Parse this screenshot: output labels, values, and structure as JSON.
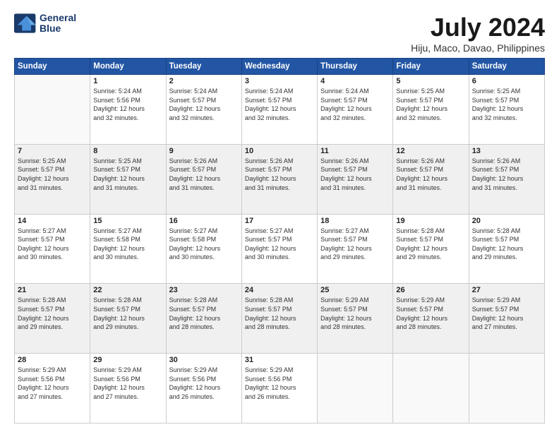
{
  "logo": {
    "line1": "General",
    "line2": "Blue"
  },
  "title": "July 2024",
  "location": "Hiju, Maco, Davao, Philippines",
  "days_of_week": [
    "Sunday",
    "Monday",
    "Tuesday",
    "Wednesday",
    "Thursday",
    "Friday",
    "Saturday"
  ],
  "weeks": [
    [
      {
        "day": "",
        "info": ""
      },
      {
        "day": "1",
        "info": "Sunrise: 5:24 AM\nSunset: 5:56 PM\nDaylight: 12 hours\nand 32 minutes."
      },
      {
        "day": "2",
        "info": "Sunrise: 5:24 AM\nSunset: 5:57 PM\nDaylight: 12 hours\nand 32 minutes."
      },
      {
        "day": "3",
        "info": "Sunrise: 5:24 AM\nSunset: 5:57 PM\nDaylight: 12 hours\nand 32 minutes."
      },
      {
        "day": "4",
        "info": "Sunrise: 5:24 AM\nSunset: 5:57 PM\nDaylight: 12 hours\nand 32 minutes."
      },
      {
        "day": "5",
        "info": "Sunrise: 5:25 AM\nSunset: 5:57 PM\nDaylight: 12 hours\nand 32 minutes."
      },
      {
        "day": "6",
        "info": "Sunrise: 5:25 AM\nSunset: 5:57 PM\nDaylight: 12 hours\nand 32 minutes."
      }
    ],
    [
      {
        "day": "7",
        "info": "Sunrise: 5:25 AM\nSunset: 5:57 PM\nDaylight: 12 hours\nand 31 minutes."
      },
      {
        "day": "8",
        "info": "Sunrise: 5:25 AM\nSunset: 5:57 PM\nDaylight: 12 hours\nand 31 minutes."
      },
      {
        "day": "9",
        "info": "Sunrise: 5:26 AM\nSunset: 5:57 PM\nDaylight: 12 hours\nand 31 minutes."
      },
      {
        "day": "10",
        "info": "Sunrise: 5:26 AM\nSunset: 5:57 PM\nDaylight: 12 hours\nand 31 minutes."
      },
      {
        "day": "11",
        "info": "Sunrise: 5:26 AM\nSunset: 5:57 PM\nDaylight: 12 hours\nand 31 minutes."
      },
      {
        "day": "12",
        "info": "Sunrise: 5:26 AM\nSunset: 5:57 PM\nDaylight: 12 hours\nand 31 minutes."
      },
      {
        "day": "13",
        "info": "Sunrise: 5:26 AM\nSunset: 5:57 PM\nDaylight: 12 hours\nand 31 minutes."
      }
    ],
    [
      {
        "day": "14",
        "info": "Sunrise: 5:27 AM\nSunset: 5:57 PM\nDaylight: 12 hours\nand 30 minutes."
      },
      {
        "day": "15",
        "info": "Sunrise: 5:27 AM\nSunset: 5:58 PM\nDaylight: 12 hours\nand 30 minutes."
      },
      {
        "day": "16",
        "info": "Sunrise: 5:27 AM\nSunset: 5:58 PM\nDaylight: 12 hours\nand 30 minutes."
      },
      {
        "day": "17",
        "info": "Sunrise: 5:27 AM\nSunset: 5:57 PM\nDaylight: 12 hours\nand 30 minutes."
      },
      {
        "day": "18",
        "info": "Sunrise: 5:27 AM\nSunset: 5:57 PM\nDaylight: 12 hours\nand 29 minutes."
      },
      {
        "day": "19",
        "info": "Sunrise: 5:28 AM\nSunset: 5:57 PM\nDaylight: 12 hours\nand 29 minutes."
      },
      {
        "day": "20",
        "info": "Sunrise: 5:28 AM\nSunset: 5:57 PM\nDaylight: 12 hours\nand 29 minutes."
      }
    ],
    [
      {
        "day": "21",
        "info": "Sunrise: 5:28 AM\nSunset: 5:57 PM\nDaylight: 12 hours\nand 29 minutes."
      },
      {
        "day": "22",
        "info": "Sunrise: 5:28 AM\nSunset: 5:57 PM\nDaylight: 12 hours\nand 29 minutes."
      },
      {
        "day": "23",
        "info": "Sunrise: 5:28 AM\nSunset: 5:57 PM\nDaylight: 12 hours\nand 28 minutes."
      },
      {
        "day": "24",
        "info": "Sunrise: 5:28 AM\nSunset: 5:57 PM\nDaylight: 12 hours\nand 28 minutes."
      },
      {
        "day": "25",
        "info": "Sunrise: 5:29 AM\nSunset: 5:57 PM\nDaylight: 12 hours\nand 28 minutes."
      },
      {
        "day": "26",
        "info": "Sunrise: 5:29 AM\nSunset: 5:57 PM\nDaylight: 12 hours\nand 28 minutes."
      },
      {
        "day": "27",
        "info": "Sunrise: 5:29 AM\nSunset: 5:57 PM\nDaylight: 12 hours\nand 27 minutes."
      }
    ],
    [
      {
        "day": "28",
        "info": "Sunrise: 5:29 AM\nSunset: 5:56 PM\nDaylight: 12 hours\nand 27 minutes."
      },
      {
        "day": "29",
        "info": "Sunrise: 5:29 AM\nSunset: 5:56 PM\nDaylight: 12 hours\nand 27 minutes."
      },
      {
        "day": "30",
        "info": "Sunrise: 5:29 AM\nSunset: 5:56 PM\nDaylight: 12 hours\nand 26 minutes."
      },
      {
        "day": "31",
        "info": "Sunrise: 5:29 AM\nSunset: 5:56 PM\nDaylight: 12 hours\nand 26 minutes."
      },
      {
        "day": "",
        "info": ""
      },
      {
        "day": "",
        "info": ""
      },
      {
        "day": "",
        "info": ""
      }
    ]
  ]
}
